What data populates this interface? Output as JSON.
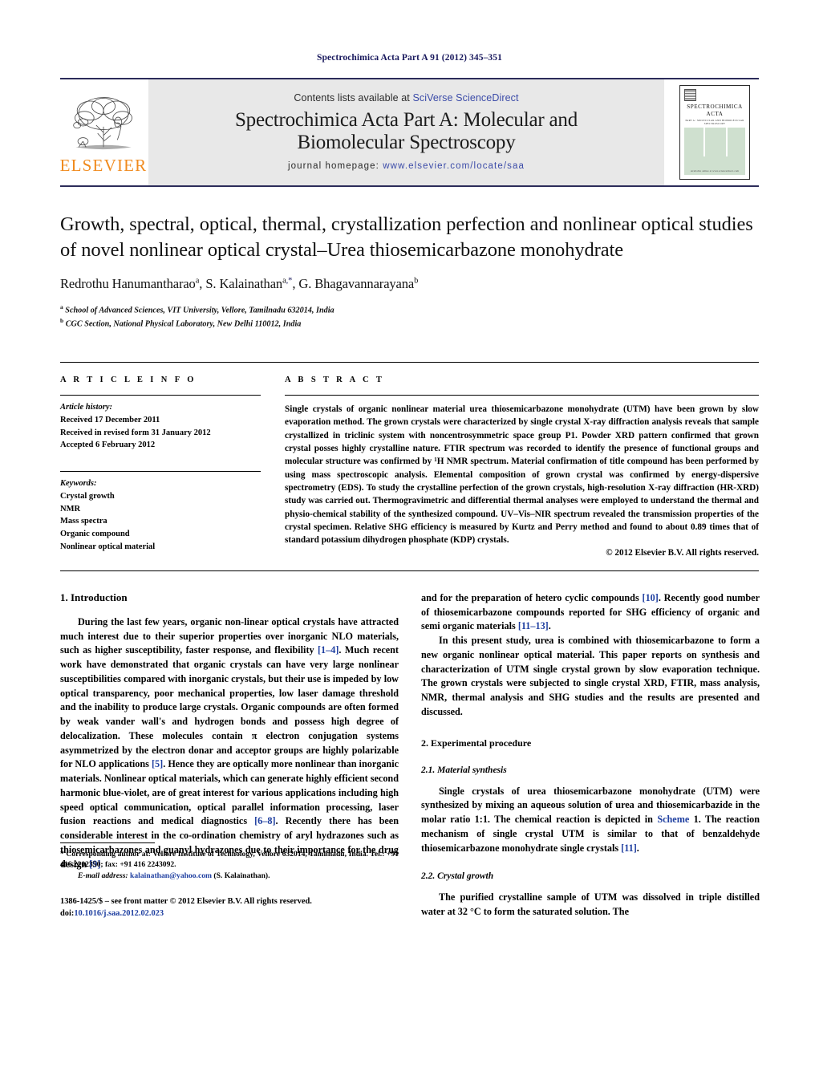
{
  "running_head": "Spectrochimica Acta Part A 91 (2012) 345–351",
  "masthead": {
    "publisher_name": "ELSEVIER",
    "contents_prefix": "Contents lists available at",
    "contents_link": "SciVerse ScienceDirect",
    "journal_title_line1": "Spectrochimica Acta Part A: Molecular and",
    "journal_title_line2": "Biomolecular Spectroscopy",
    "homepage_label": "journal homepage:",
    "homepage_url": "www.elsevier.com/locate/saa",
    "cover": {
      "title_line1": "SPECTROCHIMICA",
      "title_line2": "ACTA",
      "subtitle": "PART A : MOLECULAR AND BIOMOLECULAR SPECTROSCOPY",
      "footer": "Available online at www.sciencedirect.com"
    }
  },
  "article": {
    "title": "Growth, spectral, optical, thermal, crystallization perfection and nonlinear optical studies of novel nonlinear optical crystal–Urea thiosemicarbazone monohydrate",
    "authors_html": "Redrothu Hanumantharao<sup>a</sup>, S. Kalainathan<sup>a</sup><sup class=\"star\">,*</sup>, G. Bhagavannarayana<sup>b</sup>",
    "affiliations": [
      {
        "marker": "a",
        "text": "School of Advanced Sciences, VIT University, Vellore, Tamilnadu 632014, India"
      },
      {
        "marker": "b",
        "text": "CGC Section, National Physical Laboratory, New Delhi 110012, India"
      }
    ]
  },
  "article_info": {
    "heading": "A R T I C L E   I N F O",
    "history_label": "Article history:",
    "history": [
      "Received 17 December 2011",
      "Received in revised form 31 January 2012",
      "Accepted 6 February 2012"
    ],
    "keywords_label": "Keywords:",
    "keywords": [
      "Crystal growth",
      "NMR",
      "Mass spectra",
      "Organic compound",
      "Nonlinear optical material"
    ]
  },
  "abstract": {
    "heading": "A B S T R A C T",
    "text": "Single crystals of organic nonlinear material urea thiosemicarbazone monohydrate (UTM) have been grown by slow evaporation method. The grown crystals were characterized by single crystal X-ray diffraction analysis reveals that sample crystallized in triclinic system with noncentrosymmetric space group P1. Powder XRD pattern confirmed that grown crystal posses highly crystalline nature. FTIR spectrum was recorded to identify the presence of functional groups and molecular structure was confirmed by ¹H NMR spectrum. Material confirmation of title compound has been performed by using mass spectroscopic analysis. Elemental composition of grown crystal was confirmed by energy-dispersive spectrometry (EDS). To study the crystalline perfection of the grown crystals, high-resolution X-ray diffraction (HR-XRD) study was carried out. Thermogravimetric and differential thermal analyses were employed to understand the thermal and physio-chemical stability of the synthesized compound. UV–Vis–NIR spectrum revealed the transmission properties of the crystal specimen. Relative SHG efficiency is measured by Kurtz and Perry method and found to about 0.89 times that of standard potassium dihydrogen phosphate (KDP) crystals.",
    "copyright": "© 2012 Elsevier B.V. All rights reserved."
  },
  "body": {
    "section1_heading": "1.  Introduction",
    "intro_p1_a": "During the last few years, organic non-linear optical crystals have attracted much interest due to their superior properties over inorganic NLO materials, such as higher susceptibility, faster response, and flexibility ",
    "intro_ref_1_4": "[1–4]",
    "intro_p1_b": ". Much recent work have demonstrated that organic crystals can have very large nonlinear susceptibilities compared with inorganic crystals, but their use is impeded by low optical transparency, poor mechanical properties, low laser damage threshold and the inability to produce large crystals. Organic compounds are often formed by weak vander wall's and hydrogen bonds and possess high degree of delocalization. These molecules contain π electron conjugation systems asymmetrized by the electron donar and acceptor groups are highly polarizable for NLO applications ",
    "intro_ref_5": "[5]",
    "intro_p1_c": ". Hence they are optically more nonlinear than inorganic materials. Nonlinear optical materials, which can generate highly efficient second harmonic blue-violet, are of great interest for various applications including high speed optical communication, optical parallel information processing, laser fusion reactions and medical diagnostics ",
    "intro_ref_6_8": "[6–8]",
    "intro_p1_d": ". Recently there has been considerable interest in the co-ordination chemistry of aryl hydrazones such as thiosemicarbazones and guanyl hydrazones due to their importance for the drug design ",
    "intro_ref_9": "[9]",
    "intro_p1_e": " and for the preparation of hetero cyclic compounds ",
    "intro_ref_10": "[10]",
    "intro_p1_f": ". Recently good number of thiosemicarbazone compounds reported for SHG efficiency of organic and semi organic materials ",
    "intro_ref_11_13": "[11–13]",
    "intro_p1_g": ".",
    "intro_p2": "In this present study, urea is combined with thiosemicarbazone to form a new organic nonlinear optical material. This paper reports on synthesis and characterization of UTM single crystal grown by slow evaporation technique. The grown crystals were subjected to single crystal XRD, FTIR, mass analysis, NMR, thermal analysis and SHG studies and the results are presented and discussed.",
    "section2_heading": "2.  Experimental procedure",
    "section21_heading": "2.1.  Material synthesis",
    "mat_p1_a": "Single crystals of urea thiosemicarbazone monohydrate (UTM) were synthesized by mixing an aqueous solution of urea and thiosemicarbazide in the molar ratio 1:1. The chemical reaction is depicted in ",
    "mat_scheme_link": "Scheme",
    "mat_p1_b": " 1. The reaction mechanism of single crystal UTM is similar to that of benzaldehyde thiosemicarbazone monohydrate single crystals ",
    "mat_ref_11": "[11]",
    "mat_p1_c": ".",
    "section22_heading": "2.2.  Crystal growth",
    "growth_p1": "The purified crystalline sample of UTM was dissolved in triple distilled water at 32 °C to form the saturated solution. The"
  },
  "footnotes": {
    "corresponding": "* Corresponding author at: Vellore Institute of Technology, Vellore 632014, Tamilnadu, India. Tel.: +91 416 2202350; fax: +91 416 2243092.",
    "email_label": "E-mail address:",
    "email": "kalainathan@yahoo.com",
    "email_owner": "(S. Kalainathan).",
    "imprint_line": "1386-1425/$ – see front matter © 2012 Elsevier B.V. All rights reserved.",
    "doi_label": "doi:",
    "doi_value": "10.1016/j.saa.2012.02.023"
  }
}
